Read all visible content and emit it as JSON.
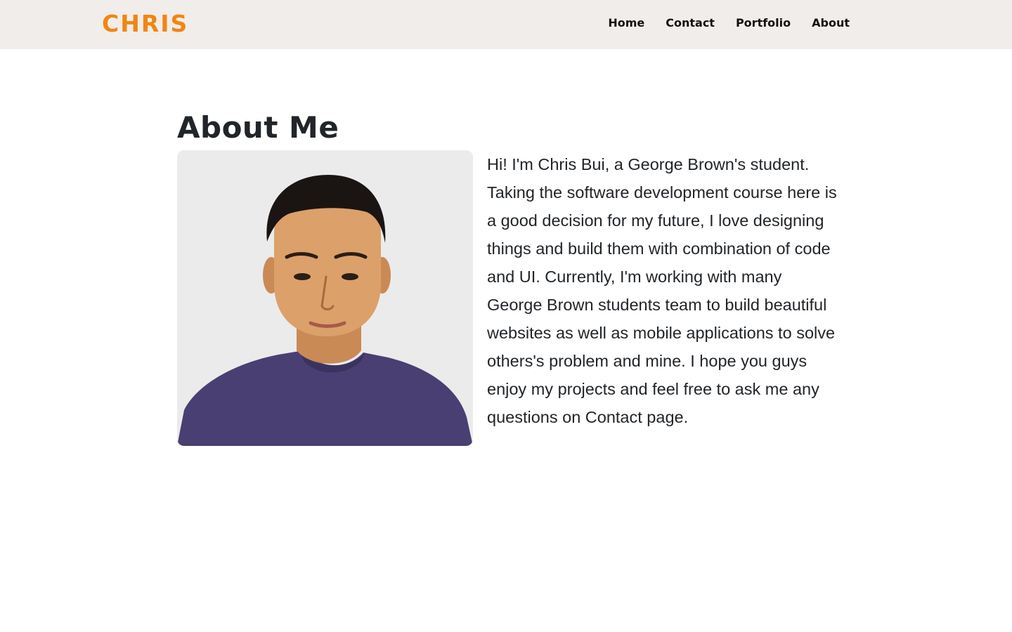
{
  "brand": {
    "name": "CHRIS",
    "color": "#f08612"
  },
  "nav": {
    "background": "#f1edea",
    "links": [
      {
        "label": "Home"
      },
      {
        "label": "Contact"
      },
      {
        "label": "Portfolio"
      },
      {
        "label": "About"
      }
    ]
  },
  "about": {
    "title": "About Me",
    "photo_icon": "portrait-photo",
    "bio": "Hi! I'm Chris Bui, a George Brown's student. Taking the software development course here is a good decision for my future, I love designing things and build them with combination of code and UI. Currently, I'm working with many George Brown students team to build beautiful websites as well as mobile applications to solve others's problem and mine. I hope you guys enjoy my projects and feel free to ask me any questions on Contact page."
  }
}
